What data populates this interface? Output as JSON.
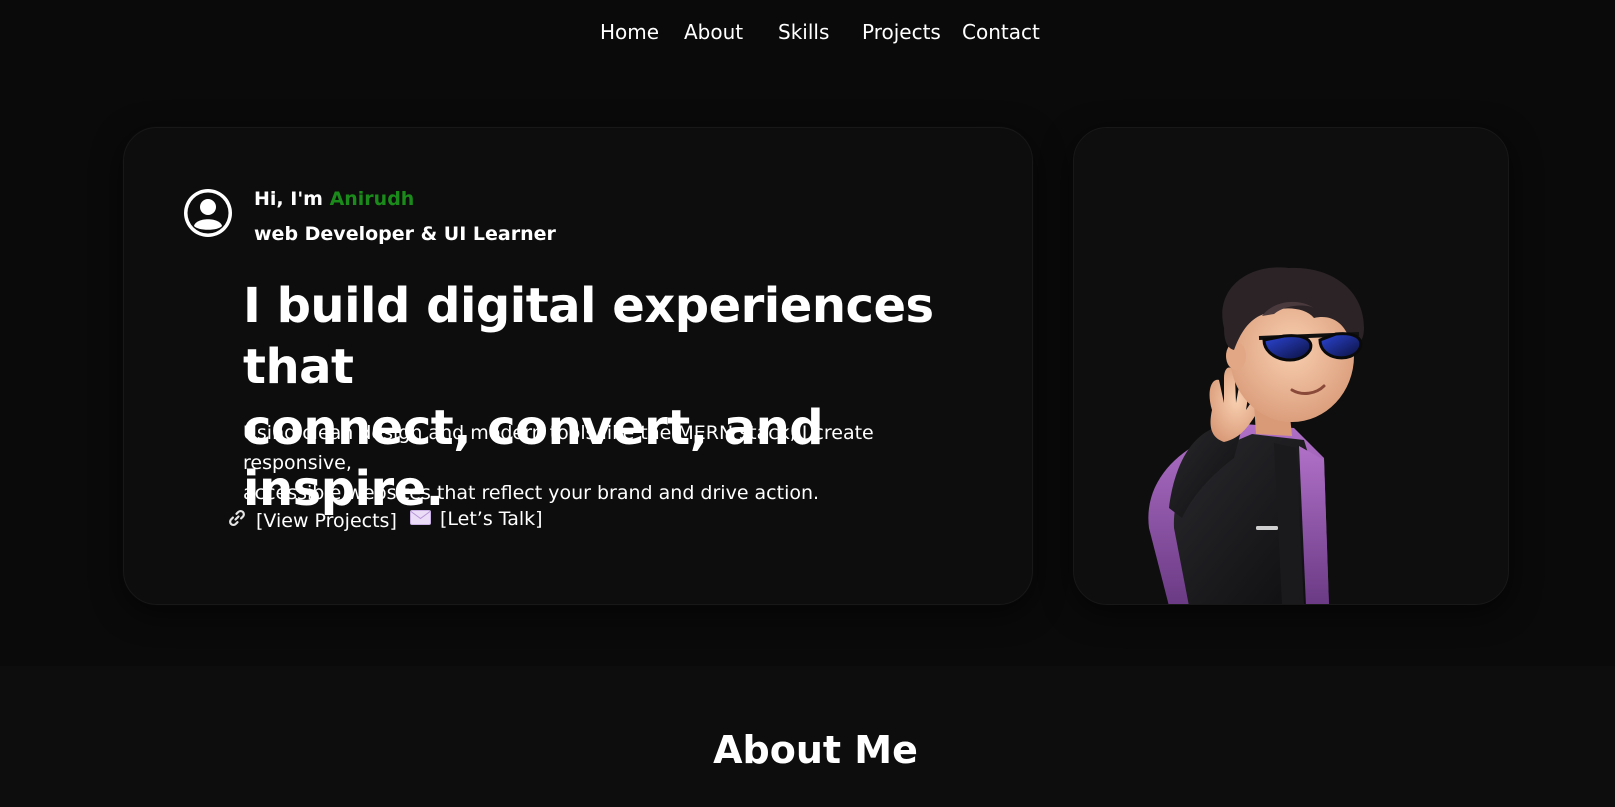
{
  "nav": {
    "items": [
      {
        "label": "Home"
      },
      {
        "label": "About"
      },
      {
        "label": "Skills"
      },
      {
        "label": "Projects"
      },
      {
        "label": "Contact"
      }
    ]
  },
  "hero": {
    "greeting_prefix": "Hi, I'm",
    "name": "Anirudh",
    "role": "web Developer & UI Learner",
    "headline_line1": "I build digital experiences that",
    "headline_line2": "connect, convert, and inspire.",
    "subtext_line1": "Using clean design and modern tools like the MERN stack, I create responsive,",
    "subtext_line2": "accessible websites that reflect your brand and drive action.",
    "cta_projects": "[View Projects]",
    "cta_talk": "[Let’s Talk]",
    "cta_projects_icon": "link-icon",
    "cta_talk_icon": "envelope-icon",
    "name_color": "#1a8a1a"
  },
  "avatar": {
    "icon": "waving-boy-avatar"
  },
  "about": {
    "title": "About Me"
  }
}
